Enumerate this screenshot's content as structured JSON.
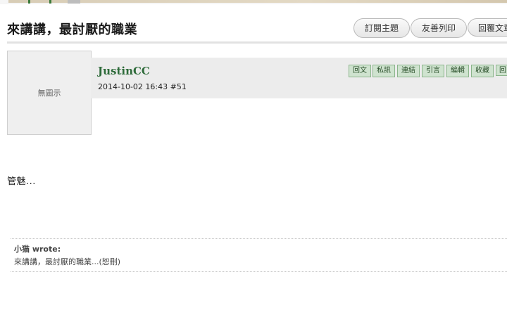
{
  "thread": {
    "title": "來講講，最討厭的職業",
    "actions": [
      "訂閱主題",
      "友善列印",
      "回覆文章"
    ]
  },
  "post": {
    "avatar_text": "無圖示",
    "author": "JustinCC",
    "meta": "2014-10-02 16:43  #51",
    "actions": [
      "回文",
      "私訊",
      "連結",
      "引言",
      "編輯",
      "收藏",
      "回"
    ],
    "body": "管魅...",
    "quote": {
      "author": "小猫 wrote:",
      "text": "來講講，最討厭的職業...(恕刪)"
    }
  },
  "colors": {
    "author": "#2e6b3a",
    "action_tag_bg": "#cfe3cf",
    "header_bg": "#ececec"
  }
}
